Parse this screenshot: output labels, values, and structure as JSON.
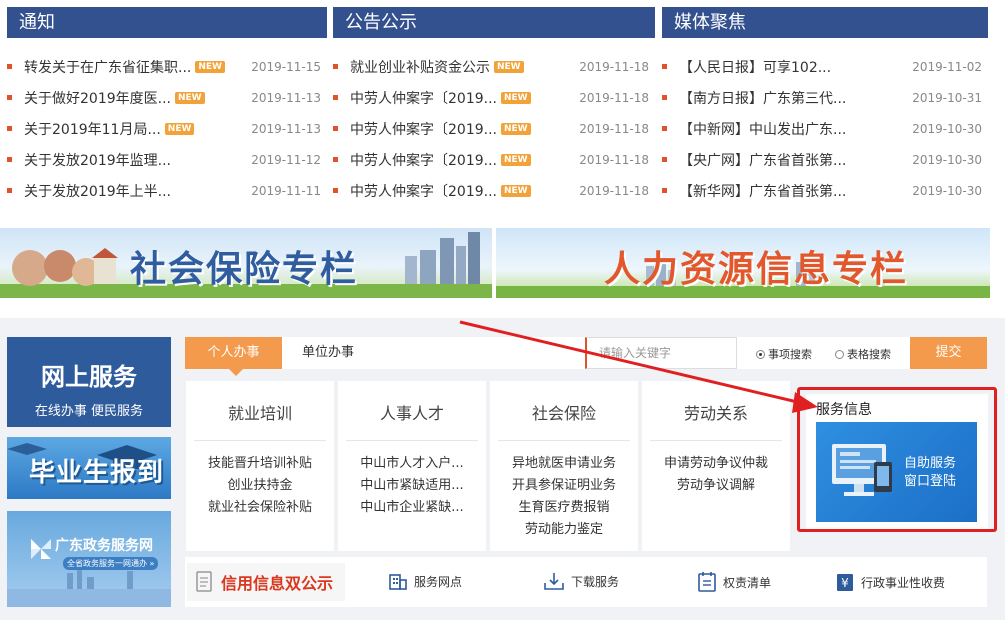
{
  "news": [
    {
      "header": "通知",
      "items": [
        {
          "title": "转发关于在广东省征集职...",
          "new": true,
          "date": "2019-11-15"
        },
        {
          "title": "关于做好2019年度医...",
          "new": true,
          "date": "2019-11-13"
        },
        {
          "title": "关于2019年11月局...",
          "new": true,
          "date": "2019-11-13"
        },
        {
          "title": "关于发放2019年监理...",
          "new": false,
          "date": "2019-11-12"
        },
        {
          "title": "关于发放2019年上半...",
          "new": false,
          "date": "2019-11-11"
        }
      ]
    },
    {
      "header": "公告公示",
      "items": [
        {
          "title": "就业创业补贴资金公示",
          "new": true,
          "date": "2019-11-18"
        },
        {
          "title": "中劳人仲案字〔2019...",
          "new": true,
          "date": "2019-11-18"
        },
        {
          "title": "中劳人仲案字〔2019...",
          "new": true,
          "date": "2019-11-18"
        },
        {
          "title": "中劳人仲案字〔2019...",
          "new": true,
          "date": "2019-11-18"
        },
        {
          "title": "中劳人仲案字〔2019...",
          "new": true,
          "date": "2019-11-18"
        }
      ]
    },
    {
      "header": "媒体聚焦",
      "items": [
        {
          "title": "【人民日报】可享102...",
          "new": false,
          "date": "2019-11-02"
        },
        {
          "title": "【南方日报】广东第三代...",
          "new": false,
          "date": "2019-10-31"
        },
        {
          "title": "【中新网】中山发出广东...",
          "new": false,
          "date": "2019-10-30"
        },
        {
          "title": "【央广网】广东省首张第...",
          "new": false,
          "date": "2019-10-30"
        },
        {
          "title": "【新华网】广东省首张第...",
          "new": false,
          "date": "2019-10-30"
        }
      ]
    }
  ],
  "new_badge": "NEW",
  "banners": {
    "social_insurance": "社会保险专栏",
    "hr_info": "人力资源信息专栏"
  },
  "left": {
    "online_title": "网上服务",
    "online_sub": "在线办事 便民服务",
    "graduate": "毕业生报到",
    "gd_title": "广东政务服务网",
    "gd_sub": "全省政务服务一网通办 »"
  },
  "tabs": {
    "personal": "个人办事",
    "unit": "单位办事"
  },
  "search": {
    "placeholder": "请输入关键字",
    "radio_item": "事项搜索",
    "radio_form": "表格搜索",
    "submit": "提交"
  },
  "categories": [
    {
      "title": "就业培训",
      "links": [
        "技能晋升培训补贴",
        "创业扶持金",
        "就业社会保险补贴"
      ]
    },
    {
      "title": "人事人才",
      "links": [
        "中山市人才入户...",
        "中山市紧缺适用...",
        "中山市企业紧缺..."
      ]
    },
    {
      "title": "社会保险",
      "links": [
        "异地就医申请业务",
        "开具参保证明业务",
        "生育医疗费报销",
        "劳动能力鉴定"
      ]
    },
    {
      "title": "劳动关系",
      "links": [
        "申请劳动争议仲裁",
        "劳动争议调解"
      ]
    }
  ],
  "service_info": {
    "title": "服务信息",
    "label_line1": "自助服务",
    "label_line2": "窗口登陆"
  },
  "bottom_links": {
    "credit": "信用信息双公示",
    "outlets": "服务网点",
    "download": "下载服务",
    "power_list": "权责清单",
    "fees": "行政事业性收费"
  },
  "colors": {
    "header_blue": "#33508f",
    "accent_orange": "#f49a4d",
    "bullet_red": "#e0532a",
    "highlight_red": "#e02020"
  }
}
